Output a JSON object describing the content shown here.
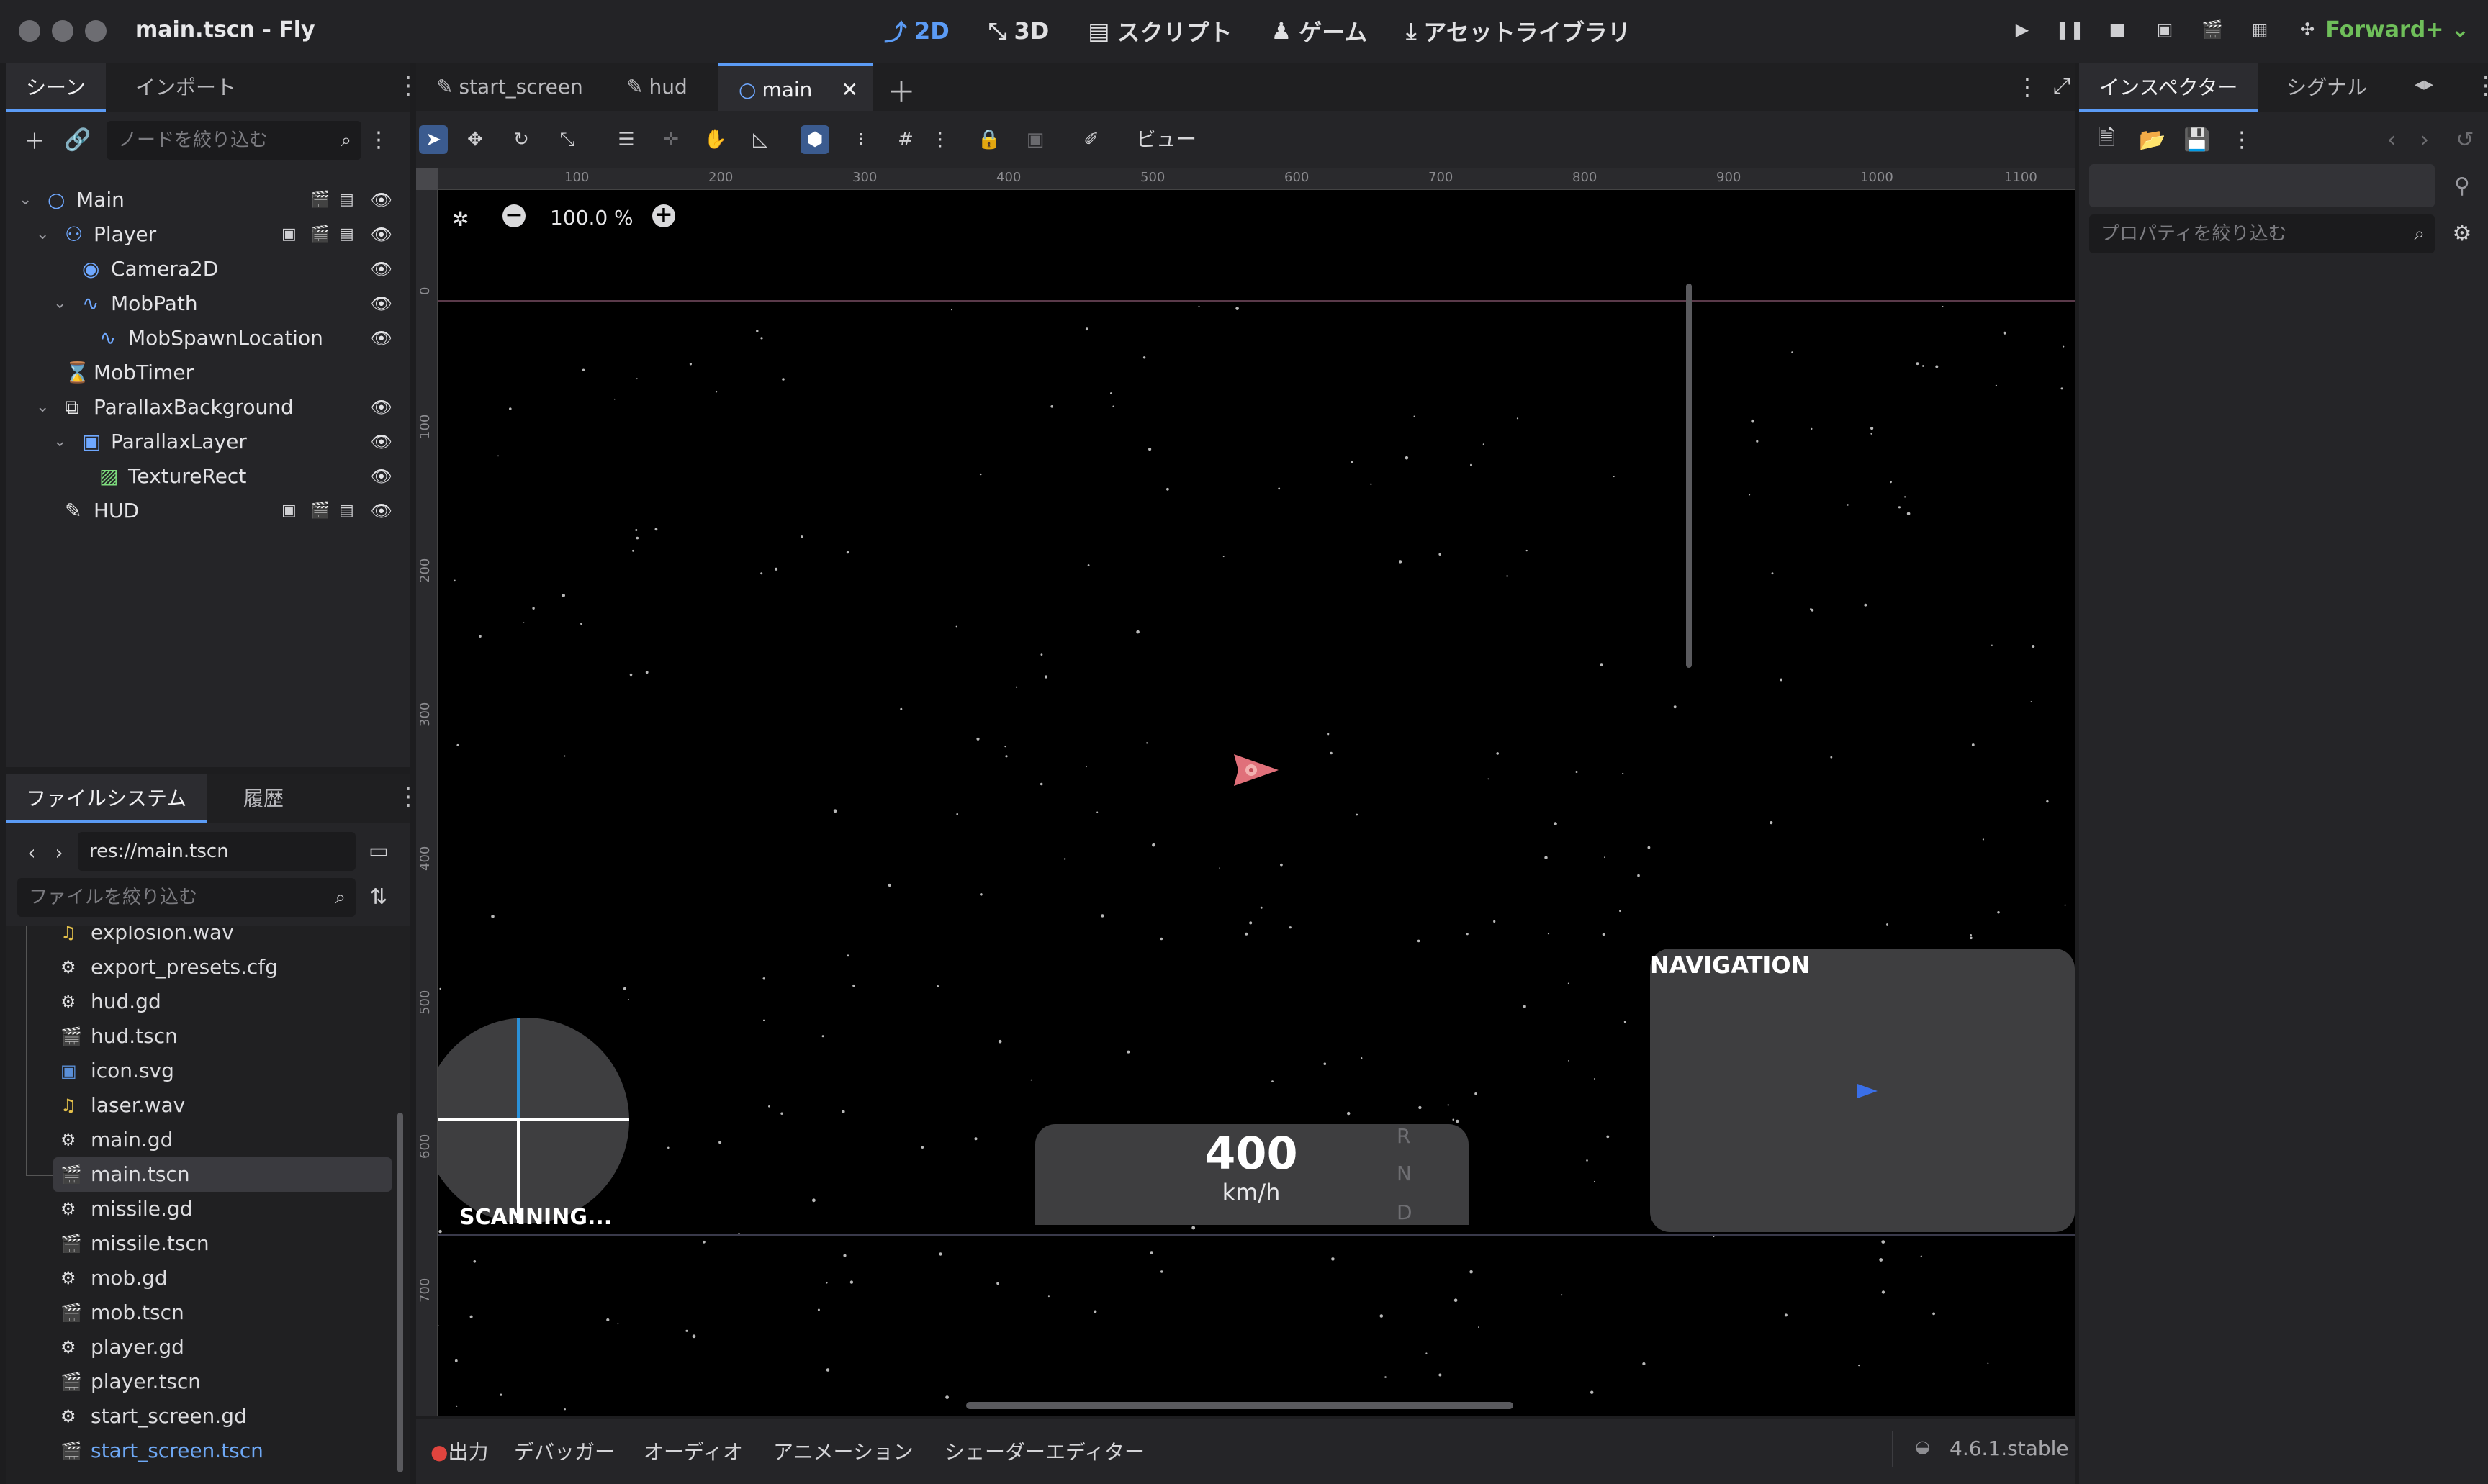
{
  "window": {
    "title": "main.tscn - Fly"
  },
  "modes": [
    {
      "label": "2D",
      "icon": "2d-icon",
      "active": true
    },
    {
      "label": "3D",
      "icon": "3d-icon",
      "active": false
    },
    {
      "label": "スクリプト",
      "icon": "script-icon",
      "active": false
    },
    {
      "label": "ゲーム",
      "icon": "game-icon",
      "active": false
    },
    {
      "label": "アセットライブラリ",
      "icon": "asset-lib-icon",
      "active": false
    }
  ],
  "renderer": "Forward+",
  "scene_panel": {
    "tabs": [
      "シーン",
      "インポート"
    ],
    "filter_placeholder": "ノードを絞り込む",
    "nodes": [
      {
        "label": "Main",
        "depth": 0,
        "icon": "node2d-icon",
        "color": "#6fa8ff",
        "expanded": true
      },
      {
        "label": "Player",
        "depth": 1,
        "icon": "area2d-icon",
        "color": "#6fa8ff",
        "expanded": true
      },
      {
        "label": "Camera2D",
        "depth": 2,
        "icon": "camera2d-icon",
        "color": "#6fa8ff"
      },
      {
        "label": "MobPath",
        "depth": 2,
        "icon": "path2d-icon",
        "color": "#6fa8ff",
        "expanded": true
      },
      {
        "label": "MobSpawnLocation",
        "depth": 3,
        "icon": "pathfollow2d-icon",
        "color": "#6fa8ff"
      },
      {
        "label": "MobTimer",
        "depth": 1,
        "icon": "timer-icon",
        "color": "#e6e6e6"
      },
      {
        "label": "ParallaxBackground",
        "depth": 1,
        "icon": "parallax-background-icon",
        "color": "#e6e6e6",
        "expanded": true
      },
      {
        "label": "ParallaxLayer",
        "depth": 2,
        "icon": "parallax-layer-icon",
        "color": "#6fa8ff",
        "expanded": true
      },
      {
        "label": "TextureRect",
        "depth": 3,
        "icon": "texture-rect-icon",
        "color": "#7ddc7d"
      },
      {
        "label": "HUD",
        "depth": 1,
        "icon": "canvas-layer-icon",
        "color": "#e6e6e6"
      }
    ]
  },
  "filesystem_panel": {
    "tabs": [
      "ファイルシステム",
      "履歴"
    ],
    "path": "res://main.tscn",
    "filter_placeholder": "ファイルを絞り込む",
    "files": [
      {
        "name": "explosion.wav",
        "icon": "audio-icon"
      },
      {
        "name": "export_presets.cfg",
        "icon": "gear-icon"
      },
      {
        "name": "hud.gd",
        "icon": "gear-icon"
      },
      {
        "name": "hud.tscn",
        "icon": "scene-icon"
      },
      {
        "name": "icon.svg",
        "icon": "image-icon"
      },
      {
        "name": "laser.wav",
        "icon": "audio-icon"
      },
      {
        "name": "main.gd",
        "icon": "gear-icon"
      },
      {
        "name": "main.tscn",
        "icon": "scene-icon",
        "selected": true
      },
      {
        "name": "missile.gd",
        "icon": "gear-icon"
      },
      {
        "name": "missile.tscn",
        "icon": "scene-icon"
      },
      {
        "name": "mob.gd",
        "icon": "gear-icon"
      },
      {
        "name": "mob.tscn",
        "icon": "scene-icon"
      },
      {
        "name": "player.gd",
        "icon": "gear-icon"
      },
      {
        "name": "player.tscn",
        "icon": "scene-icon"
      },
      {
        "name": "start_screen.gd",
        "icon": "gear-icon"
      },
      {
        "name": "start_screen.tscn",
        "icon": "scene-icon",
        "highlight": true
      }
    ]
  },
  "editor_tabs": [
    {
      "label": "start_screen",
      "icon": "canvas-icon",
      "active": false
    },
    {
      "label": "hud",
      "icon": "canvas-icon",
      "active": false
    },
    {
      "label": "main",
      "icon": "node2d-icon",
      "active": true
    }
  ],
  "toolbar": {
    "view_label": "ビュー"
  },
  "viewport": {
    "zoom": "100.0 %",
    "ruler_x": [
      "100",
      "200",
      "300",
      "400",
      "500",
      "600",
      "700",
      "800",
      "900",
      "1000",
      "1100"
    ],
    "ruler_y": [
      "0",
      "100",
      "200",
      "300",
      "400",
      "500",
      "600",
      "700"
    ],
    "hud": {
      "navigation_label": "NAVIGATION",
      "speed_value": "400",
      "speed_unit": "km/h",
      "gears": [
        "R",
        "N",
        "D"
      ],
      "scanning_label": "SCANNING..."
    }
  },
  "bottom_tabs": [
    "出力",
    "デバッガー",
    "オーディオ",
    "アニメーション",
    "シェーダーエディター"
  ],
  "version": "4.6.1.stable",
  "inspector": {
    "tabs": [
      "インスペクター",
      "シグナル"
    ],
    "filter_placeholder": "プロパティを絞り込む"
  }
}
